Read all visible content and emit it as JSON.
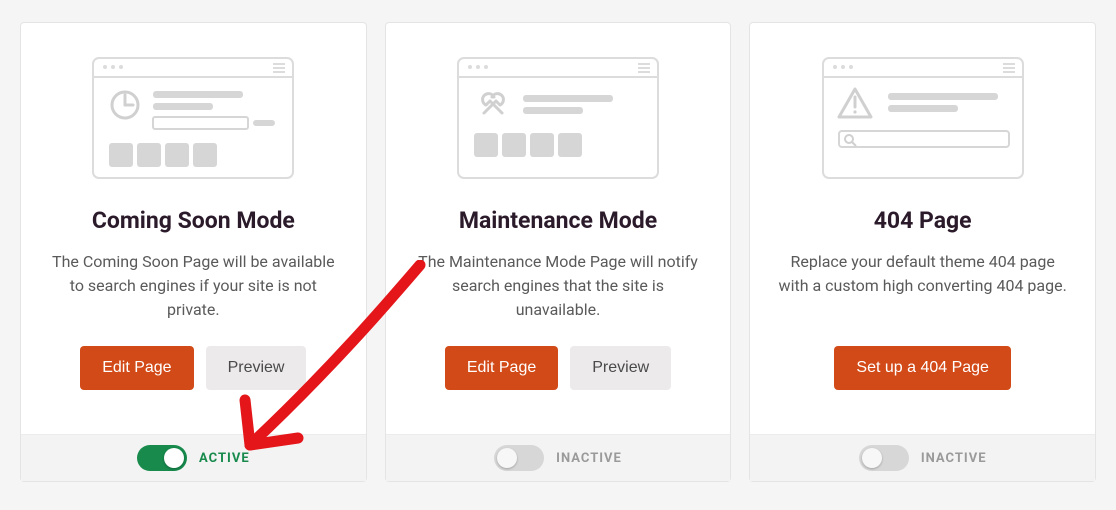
{
  "cards": [
    {
      "title": "Coming Soon Mode",
      "description": "The Coming Soon Page will be available to search engines if your site is not private.",
      "primary_btn": "Edit Page",
      "secondary_btn": "Preview",
      "active": true,
      "status_label": "ACTIVE",
      "icon": "clock"
    },
    {
      "title": "Maintenance Mode",
      "description": "The Maintenance Mode Page will notify search engines that the site is unavailable.",
      "primary_btn": "Edit Page",
      "secondary_btn": "Preview",
      "active": false,
      "status_label": "INACTIVE",
      "icon": "tools"
    },
    {
      "title": "404 Page",
      "description": "Replace your default theme 404 page with a custom high converting 404 page.",
      "primary_btn": "Set up a 404 Page",
      "secondary_btn": null,
      "active": false,
      "status_label": "INACTIVE",
      "icon": "warning"
    }
  ],
  "colors": {
    "primary": "#d24a17",
    "active": "#178a4c"
  }
}
